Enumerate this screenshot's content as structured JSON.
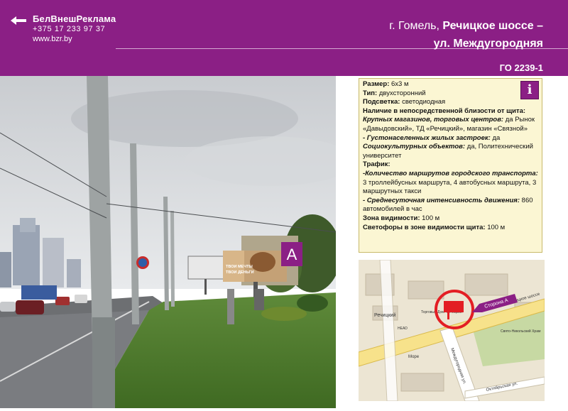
{
  "brand": {
    "name": "БелВнешРеклама",
    "phone": "+375 17 233 97 37",
    "site": "www.bzr.by"
  },
  "header": {
    "city": "г. Гомель,",
    "street1": "Речицкое шоссе –",
    "street2": "ул. Междугородняя",
    "code": "ГО 2239-1"
  },
  "photo": {
    "side_label": "А",
    "billboard_text_1": "ТВОИ МЕЧТЫ",
    "billboard_text_2": "ТВОИ ДЕНЬГИ"
  },
  "info": {
    "size_label": "Размер:",
    "size_value": "6х3 м",
    "type_label": "Тип:",
    "type_value": "двухсторонний",
    "light_label": "Подсветка:",
    "light_value": "светодиодная",
    "near_label": "Наличие в непосредственной близости от щита:",
    "shops_label": "Крупных магазинов, торговых центров:",
    "shops_value": "да Рынок «Давыдовский», ТД «Речицкий», магазин «Связной»",
    "dense_label": "- Густонаселенных жилых застроек:",
    "dense_value": "да",
    "social_label": "Социокультурных объектов:",
    "social_value": "да, Политехнический университет",
    "traffic_label": "Трафик:",
    "routes_label": "-Количество маршрутов городского транспорта:",
    "routes_value": "3 троллейбусных маршрута, 4 автобусных маршрута, 3 маршрутных такси",
    "intensity_label": "- Среднесуточная интенсивность движения:",
    "intensity_value": "860 автомобилей в час",
    "visibility_label": "Зона видимости:",
    "visibility_value": "100 м",
    "lights_label": "Светофоры в зоне видимости щита:",
    "lights_value": "100 м",
    "icon": "i"
  },
  "map": {
    "label_rechitsky": "Речицкий",
    "label_td": "Торговый Дом \"Речицкий\"",
    "label_shosse": "Речицкое шоссе",
    "label_side": "Сторона А",
    "label_church": "Свято-Никольский Храм",
    "label_mezhd": "Междугородняя ул.",
    "label_more": "Море",
    "label_oct": "Октябрьская ул.",
    "label_head": "HEAD"
  },
  "colors": {
    "brand_purple": "#8b1f85",
    "info_bg": "#fbf6d3",
    "marker_red": "#e31e24"
  }
}
